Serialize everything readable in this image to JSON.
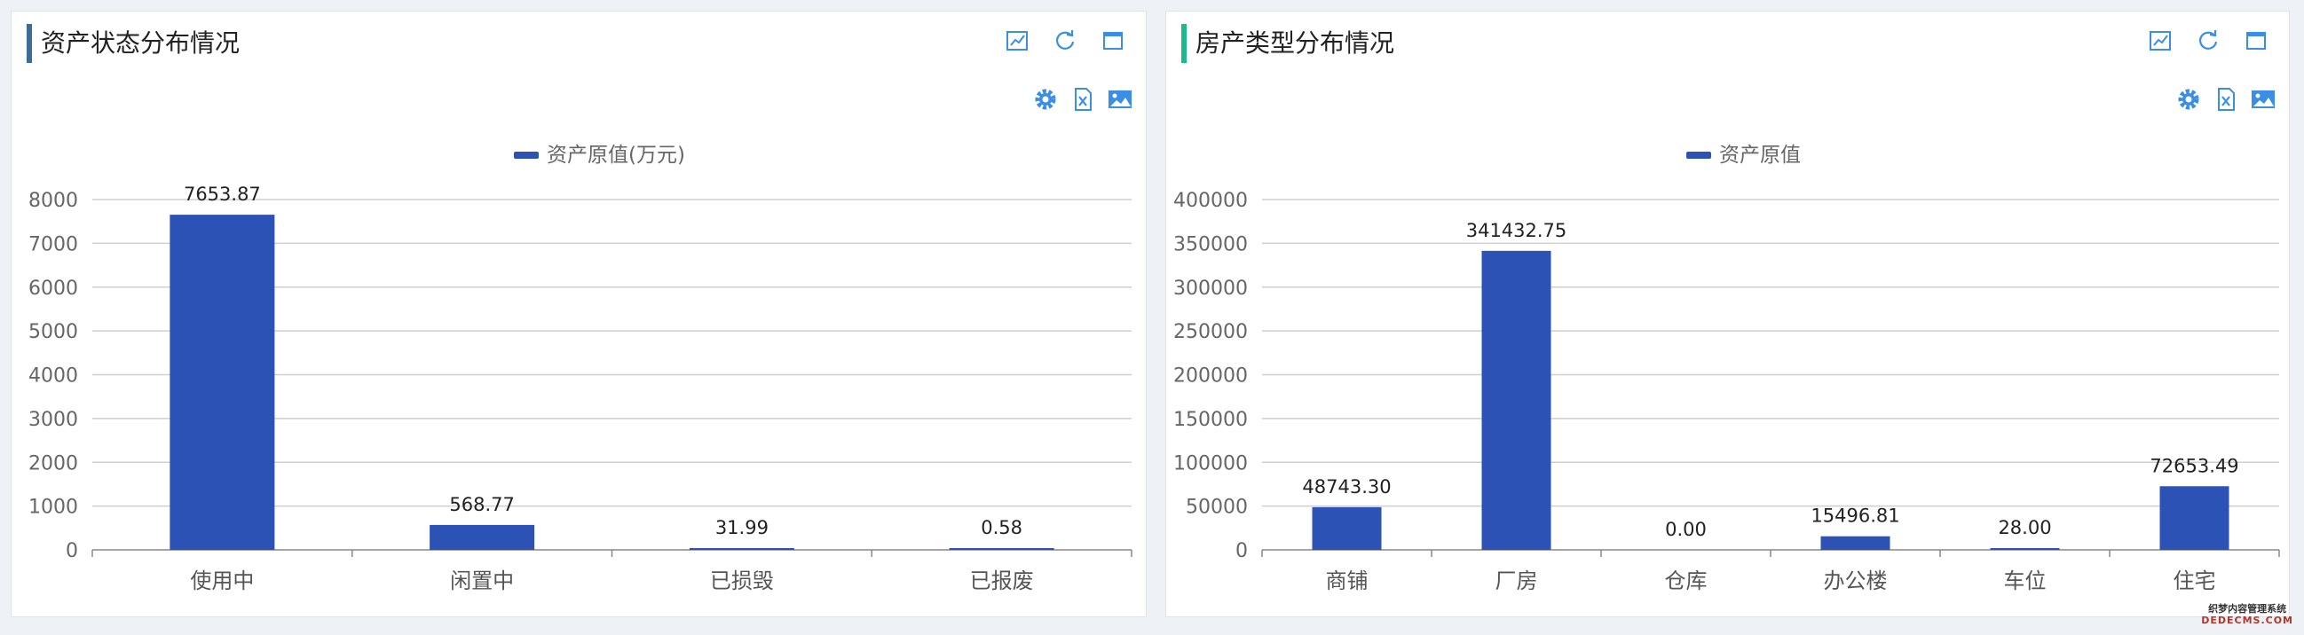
{
  "panels": [
    {
      "title": "资产状态分布情况",
      "chart_data": {
        "type": "bar",
        "title": "资产状态分布情况",
        "legend": [
          "资产原值(万元)"
        ],
        "legend_position": "top-center",
        "categories": [
          "使用中",
          "闲置中",
          "已损毁",
          "已报废"
        ],
        "series": [
          {
            "name": "资产原值(万元)",
            "values": [
              7653.87,
              568.77,
              31.99,
              0.58
            ]
          }
        ],
        "data_labels": [
          "7653.87",
          "568.77",
          "31.99",
          "0.58"
        ],
        "y_ticks": [
          0,
          1000,
          2000,
          3000,
          4000,
          5000,
          6000,
          7000,
          8000
        ],
        "ylim": [
          0,
          8000
        ],
        "grid": true,
        "bar_color": "#2d52b6"
      }
    },
    {
      "title": "房产类型分布情况",
      "chart_data": {
        "type": "bar",
        "title": "房产类型分布情况",
        "legend": [
          "资产原值"
        ],
        "legend_position": "top-center",
        "categories": [
          "商铺",
          "厂房",
          "仓库",
          "办公楼",
          "车位",
          "住宅"
        ],
        "series": [
          {
            "name": "资产原值",
            "values": [
              48743.3,
              341432.75,
              0.0,
              15496.81,
              28.0,
              72653.49
            ]
          }
        ],
        "data_labels": [
          "48743.30",
          "341432.75",
          "0.00",
          "15496.81",
          "28.00",
          "72653.49"
        ],
        "y_ticks": [
          0,
          50000,
          100000,
          150000,
          200000,
          250000,
          300000,
          350000,
          400000
        ],
        "ylim": [
          0,
          400000
        ],
        "grid": true,
        "bar_color": "#2d52b6"
      }
    }
  ],
  "icons": {
    "top": [
      "line-chart-icon",
      "refresh-icon",
      "maximize-icon"
    ],
    "tools": [
      "gear-icon",
      "excel-icon",
      "image-icon"
    ]
  },
  "watermark": {
    "line1": "织梦内容管理系统",
    "line2": "DEDECMS.COM"
  },
  "colors": {
    "accent_left": "#3b6e96",
    "accent_right": "#1aba8a",
    "icon": "#3a8ee6"
  }
}
